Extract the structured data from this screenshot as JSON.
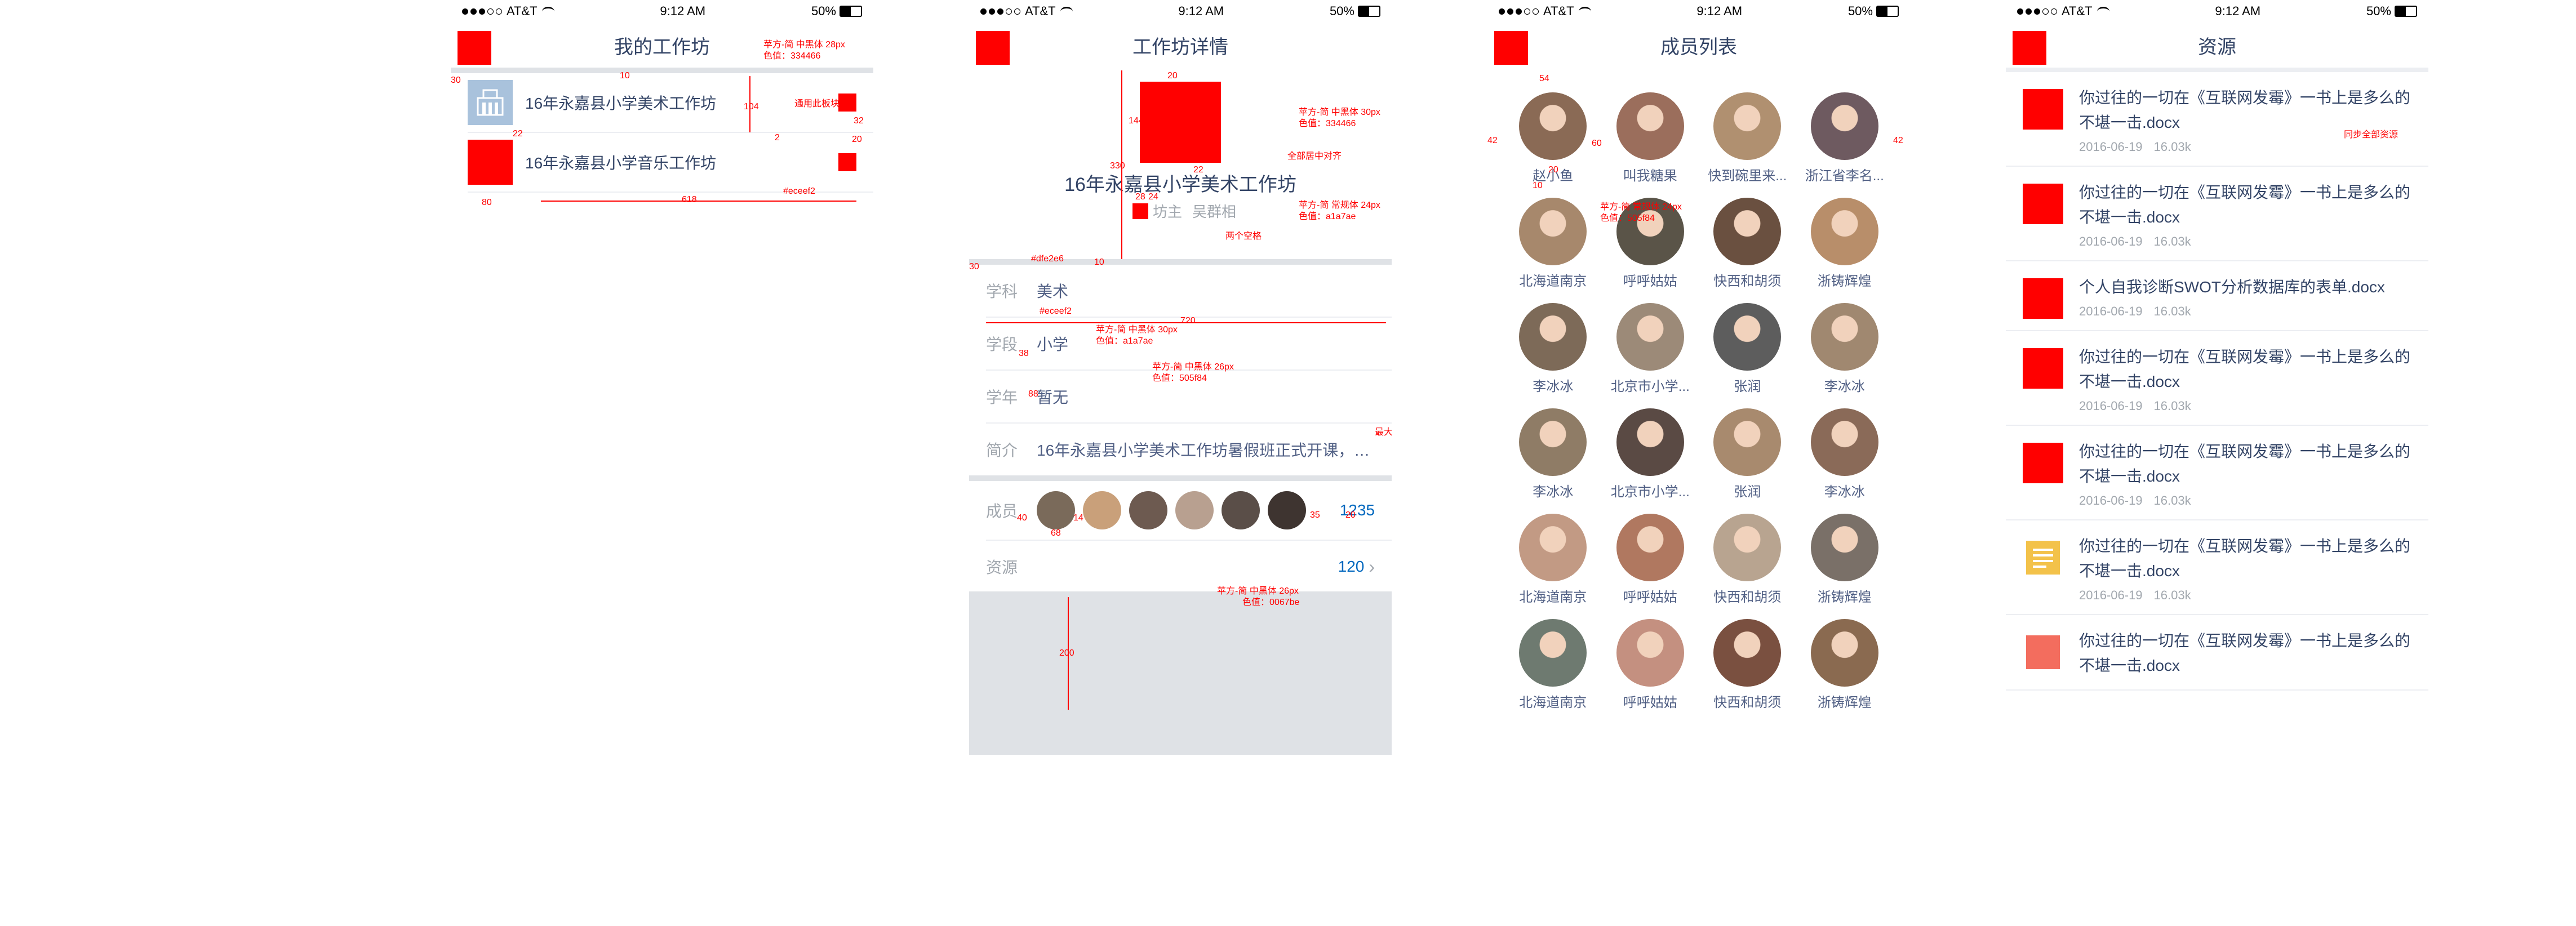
{
  "status": {
    "carrier": "AT&T",
    "time": "9:12 AM",
    "battery": "50%"
  },
  "screen1": {
    "title": "我的工作坊",
    "items": [
      {
        "label": "16年永嘉县小学美术工作坊"
      },
      {
        "label": "16年永嘉县小学音乐工作坊"
      }
    ],
    "annotations": {
      "font": "苹方-简 中黑体 28px",
      "color": "色值：334466",
      "generic": "通用此板块",
      "divider_color": "#eceef2",
      "dims": {
        "a": "30",
        "b": "10",
        "c": "104",
        "d": "22",
        "e": "32",
        "f": "20",
        "g": "2",
        "h": "80",
        "i": "618"
      }
    }
  },
  "screen2": {
    "title": "工作坊详情",
    "name": "16年永嘉县小学美术工作坊",
    "owner_label": "坊主",
    "owner_name": "吴群相",
    "rows": {
      "subject": {
        "label": "学科",
        "value": "美术"
      },
      "stage": {
        "label": "学段",
        "value": "小学"
      },
      "year": {
        "label": "学年",
        "value": "暂无"
      },
      "intro": {
        "label": "简介",
        "value": "16年永嘉县小学美术工作坊暑假班正式开课，欢..."
      },
      "members": {
        "label": "成员",
        "count": "1235"
      },
      "resources": {
        "label": "资源",
        "count": "120"
      }
    },
    "annotations": {
      "title_font": "苹方-简 中黑体 30px",
      "title_color": "色值：334466",
      "center": "全部居中对齐",
      "owner_font": "苹方-简 常规体 24px",
      "owner_color": "色值：a1a7ae",
      "two_spaces": "两个空格",
      "sep_color": "#dfe2e6",
      "line_color": "#eceef2",
      "label_font": "苹方-简 中黑体 30px",
      "label_color": "色值：a1a7ae",
      "value_font": "苹方-简 中黑体 26px",
      "value_color": "色值：505f84",
      "max_chars": "最大字体限制",
      "count_font": "苹方-简 中黑体 26px",
      "count_color": "色值：0067be",
      "dims": {
        "a": "20",
        "b": "144",
        "c": "22",
        "d": "330",
        "e": "28",
        "f": "24",
        "g": "30",
        "h": "10",
        "i": "720",
        "j": "38",
        "k": "88",
        "l": "40",
        "m": "68",
        "n": "14",
        "o": "35",
        "p": "20",
        "q": "200"
      }
    }
  },
  "screen3": {
    "title": "成员列表",
    "members": [
      {
        "name": "赵小鱼",
        "color": "#8a6a55"
      },
      {
        "name": "叫我糖果",
        "color": "#9b6e5c"
      },
      {
        "name": "快到碗里来...",
        "color": "#b09070"
      },
      {
        "name": "浙江省李名...",
        "color": "#6e5a60"
      },
      {
        "name": "北海道南京",
        "color": "#a7886c"
      },
      {
        "name": "呼呼姑姑",
        "color": "#5a5448"
      },
      {
        "name": "快西和胡须",
        "color": "#6a5040"
      },
      {
        "name": "浙铸辉煌",
        "color": "#b88e6a"
      },
      {
        "name": "李冰冰",
        "color": "#7d6a58"
      },
      {
        "name": "北京市小学...",
        "color": "#9c8a78"
      },
      {
        "name": "张润",
        "color": "#5d5d5d"
      },
      {
        "name": "李冰冰",
        "color": "#a08870"
      },
      {
        "name": "李冰冰",
        "color": "#8f7c66"
      },
      {
        "name": "北京市小学...",
        "color": "#5a4a44"
      },
      {
        "name": "张润",
        "color": "#a88a6e"
      },
      {
        "name": "李冰冰",
        "color": "#8a6a58"
      },
      {
        "name": "北海道南京",
        "color": "#c29a84"
      },
      {
        "name": "呼呼姑姑",
        "color": "#b07860"
      },
      {
        "name": "快西和胡须",
        "color": "#b8a490"
      },
      {
        "name": "浙铸辉煌",
        "color": "#7a7068"
      },
      {
        "name": "北海道南京",
        "color": "#6e7a70"
      },
      {
        "name": "呼呼姑姑",
        "color": "#c49080"
      },
      {
        "name": "快西和胡须",
        "color": "#7a5040"
      },
      {
        "name": "浙铸辉煌",
        "color": "#8a6a50"
      }
    ],
    "annotations": {
      "font": "苹方-简 常规体 24px",
      "color": "色值：505f84",
      "dims": {
        "a": "54",
        "b": "42",
        "c": "60",
        "d": "42",
        "e": "20",
        "f": "10"
      }
    }
  },
  "screen4": {
    "title": "资源",
    "items": [
      {
        "title": "你过往的一切在《互联网发霉》一书上是多么的不堪一击.docx",
        "date": "2016-06-19",
        "size": "16.03k",
        "icon": "red"
      },
      {
        "title": "你过往的一切在《互联网发霉》一书上是多么的不堪一击.docx",
        "date": "2016-06-19",
        "size": "16.03k",
        "icon": "red"
      },
      {
        "title": "个人自我诊断SWOT分析数据库的表单.docx",
        "date": "2016-06-19",
        "size": "16.03k",
        "icon": "red"
      },
      {
        "title": "你过往的一切在《互联网发霉》一书上是多么的不堪一击.docx",
        "date": "2016-06-19",
        "size": "16.03k",
        "icon": "red"
      },
      {
        "title": "你过往的一切在《互联网发霉》一书上是多么的不堪一击.docx",
        "date": "2016-06-19",
        "size": "16.03k",
        "icon": "red"
      },
      {
        "title": "你过往的一切在《互联网发霉》一书上是多么的不堪一击.docx",
        "date": "2016-06-19",
        "size": "16.03k",
        "icon": "word"
      },
      {
        "title": "你过往的一切在《互联网发霉》一书上是多么的不堪一击.docx",
        "date": "",
        "size": "",
        "icon": "orange"
      }
    ],
    "annotations": {
      "sync": "同步全部资源"
    }
  }
}
